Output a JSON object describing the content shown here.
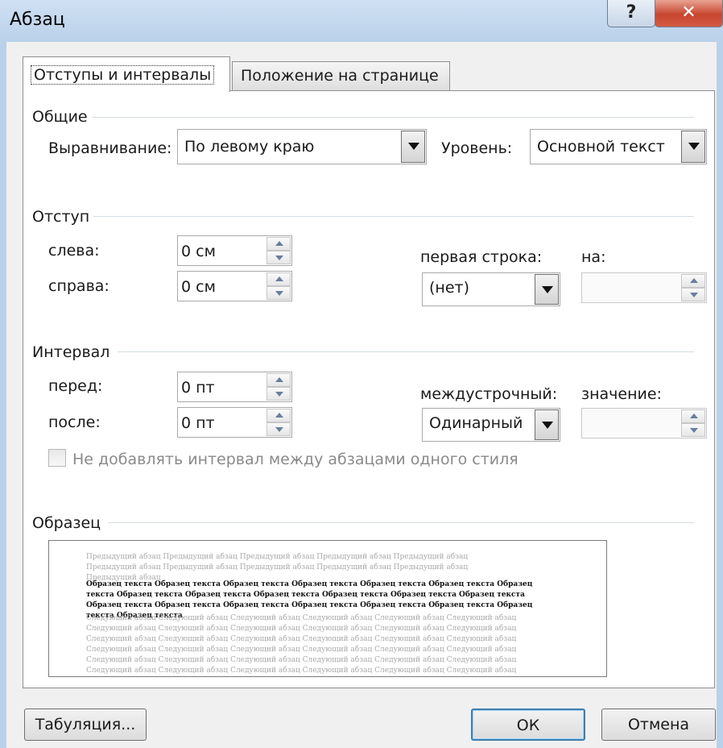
{
  "window": {
    "title": "Абзац",
    "help_glyph": "?",
    "close_glyph": "✕"
  },
  "tabs": [
    {
      "label": "Отступы и интервалы",
      "active": true
    },
    {
      "label": "Положение на странице",
      "active": false
    }
  ],
  "general": {
    "heading": "Общие",
    "alignment_label": "Выравнивание:",
    "alignment_value": "По левому краю",
    "level_label": "Уровень:",
    "level_value": "Основной текст"
  },
  "indent": {
    "heading": "Отступ",
    "left_label": "слева:",
    "left_value": "0 см",
    "right_label": "справа:",
    "right_value": "0 см",
    "first_line_label": "первая строка:",
    "first_line_value": "(нет)",
    "by_label": "на:",
    "by_value": ""
  },
  "spacing": {
    "heading": "Интервал",
    "before_label": "перед:",
    "before_value": "0 пт",
    "after_label": "после:",
    "after_value": "0 пт",
    "line_spacing_label": "междустрочный:",
    "line_spacing_value": "Одинарный",
    "at_label": "значение:",
    "at_value": "",
    "dont_add_space_label": "Не добавлять интервал между абзацами одного стиля",
    "dont_add_space_checked": false
  },
  "preview": {
    "heading": "Образец",
    "previous_text": "Предыдущий абзац Предыдущий абзац Предыдущий абзац Предыдущий абзац Предыдущий абзац Предыдущий абзац Предыдущий абзац Предыдущий абзац Предыдущий абзац Предыдущий абзац Предыдущий абзац",
    "sample_text": "Образец текста Образец текста Образец текста Образец текста Образец текста Образец текста Образец текста Образец текста Образец текста Образец текста Образец текста Образец текста Образец текста Образец текста Образец текста Образец текста Образец текста Образец текста Образец текста Образец текста Образец текста",
    "next_text": "Следующий абзац Следующий абзац Следующий абзац Следующий абзац Следующий абзац Следующий абзац Следующий абзац Следующий абзац Следующий абзац Следующий абзац Следующий абзац Следующий абзац Следующий абзац Следующий абзац Следующий абзац Следующий абзац Следующий абзац Следующий абзац Следующий абзац Следующий абзац Следующий абзац Следующий абзац Следующий абзац Следующий абзац Следующий абзац Следующий абзац Следующий абзац Следующий абзац Следующий абзац Следующий абзац Следующий абзац Следующий абзац Следующий абзац Следующий абзац Следующий абзац Следующий абзац Следующий абзац Следующий абзац Следующий абзац Следующий абзац Следующий абзац Следующий абзац Следующий абзац Следующий абзац Следующий абзац Следующий абзац Следующий абзац Следующий абзац Следующий абзац Следующий абзац Следующий абзац"
  },
  "buttons": {
    "tabs": "Табуляция...",
    "ok": "ОК",
    "cancel": "Отмена"
  },
  "colors": {
    "title_bar": "#b9d1ea",
    "close_button": "#c7452f",
    "default_button_border": "#3c7fb1"
  }
}
